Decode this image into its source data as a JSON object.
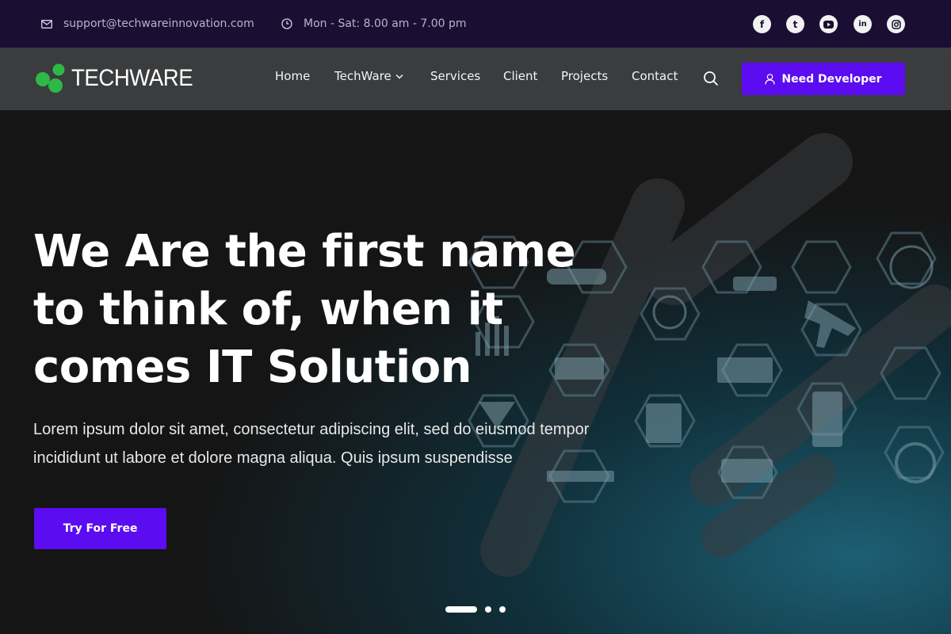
{
  "topbar": {
    "email": "support@techwareinnovation.com",
    "hours": "Mon - Sat: 8.00 am - 7.00 pm",
    "socials": [
      "facebook-icon",
      "tumblr-icon",
      "youtube-icon",
      "linkedin-icon",
      "instagram-icon"
    ]
  },
  "header": {
    "logo_text": "TECHWARE",
    "nav": [
      {
        "label": "Home"
      },
      {
        "label": "TechWare",
        "dropdown": true
      },
      {
        "label": "Services"
      },
      {
        "label": "Client"
      },
      {
        "label": "Projects"
      },
      {
        "label": "Contact"
      }
    ],
    "cta_label": "Need Developer"
  },
  "hero": {
    "title": "We Are the first name to think of, when it comes IT Solution",
    "text": "Lorem ipsum dolor sit amet, consectetur adipiscing elit, sed do eiusmod tempor incididunt ut labore et dolore magna aliqua. Quis ipsum suspendisse",
    "cta_label": "Try For Free",
    "slides": 3,
    "active_slide": 1
  },
  "colors": {
    "topbar_bg": "#1b0e33",
    "navbar_bg": "#3a3c3e",
    "accent": "#5b0cf0",
    "logo_green": "#2eb847"
  }
}
